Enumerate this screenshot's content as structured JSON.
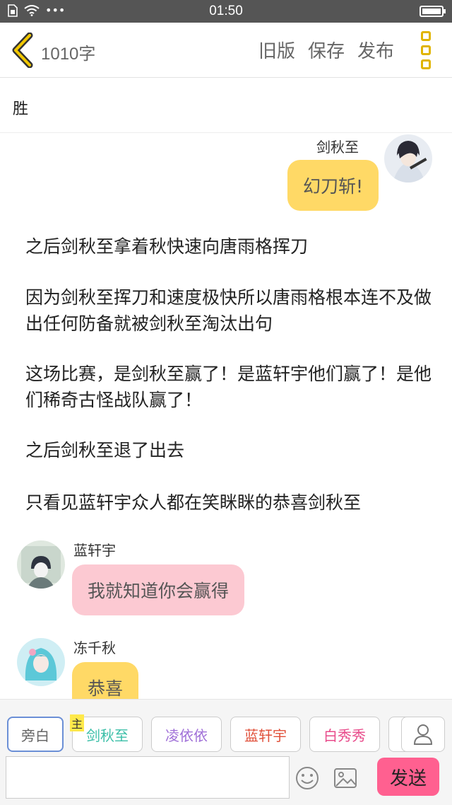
{
  "status_bar": {
    "time": "01:50",
    "dots": "•••"
  },
  "header": {
    "word_count": "1010字",
    "actions": [
      "旧版",
      "保存",
      "发布"
    ]
  },
  "chapter": {
    "title": "胜"
  },
  "messages": [
    {
      "kind": "dialog",
      "side": "right",
      "speaker": "剑秋至",
      "text": "幻刀斩!",
      "bubble_color": "#ffd966"
    },
    {
      "kind": "narration",
      "text": "之后剑秋至拿着秋快速向唐雨格挥刀"
    },
    {
      "kind": "narration",
      "text": "因为剑秋至挥刀和速度极快所以唐雨格根本连不及做出任何防备就被剑秋至淘汰出句"
    },
    {
      "kind": "narration",
      "text": "这场比赛，是剑秋至赢了！是蓝轩宇他们赢了！是他们稀奇古怪战队赢了！"
    },
    {
      "kind": "narration",
      "text": "之后剑秋至退了出去"
    },
    {
      "kind": "narration",
      "text": "只看见蓝轩宇众人都在笑眯眯的恭喜剑秋至"
    },
    {
      "kind": "dialog",
      "side": "left",
      "speaker": "蓝轩宇",
      "text": "我就知道你会赢得",
      "bubble_color": "#fcc9d2"
    },
    {
      "kind": "dialog",
      "side": "left",
      "speaker": "冻千秋",
      "text": "恭喜",
      "bubble_color": "#ffd966"
    }
  ],
  "character_tabs": [
    {
      "label": "旁白",
      "color": "#666666",
      "selected": true
    },
    {
      "label": "剑秋至",
      "color": "#3cbfa8",
      "badge": "主"
    },
    {
      "label": "凌依依",
      "color": "#a070d8"
    },
    {
      "label": "蓝轩宇",
      "color": "#e0503a"
    },
    {
      "label": "白秀秀",
      "color": "#e84a8a"
    }
  ],
  "composer": {
    "placeholder": "",
    "send_label": "发送"
  },
  "colors": {
    "accent": "#e0b400",
    "send": "#ff6090",
    "status_bar": "#555555"
  }
}
